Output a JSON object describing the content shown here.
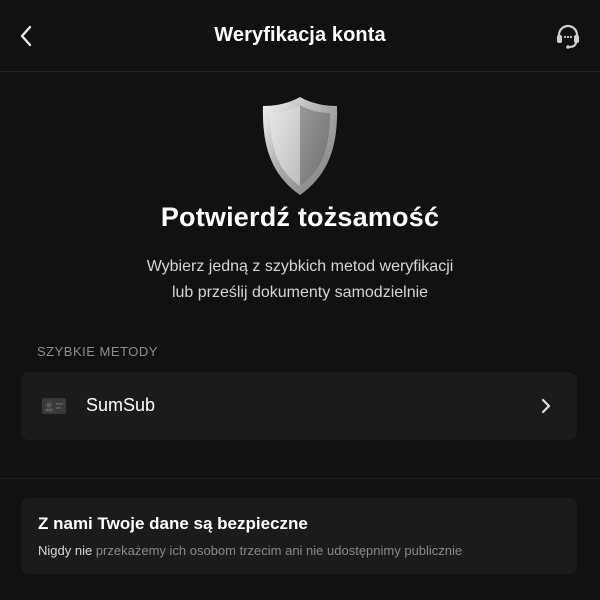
{
  "header": {
    "title": "Weryfikacja konta",
    "back_icon": "chevron-left-icon",
    "support_icon": "headset-support-icon"
  },
  "hero": {
    "icon": "shield-icon",
    "title": "Potwierdź tożsamość",
    "subtitle_line1": "Wybierz jedną z szybkich metod weryfikacji",
    "subtitle_line2": "lub prześlij dokumenty samodzielnie"
  },
  "quick_methods": {
    "section_label": "SZYBKIE METODY",
    "items": [
      {
        "label": "SumSub",
        "icon": "id-card-icon",
        "trailing_icon": "chevron-right-icon"
      }
    ]
  },
  "info": {
    "title": "Z nami Twoje dane są bezpieczne",
    "text_emphasis": "Nigdy nie",
    "text_rest": " przekażemy ich osobom trzecim ani nie udostępnimy publicznie"
  },
  "colors": {
    "background": "#111111",
    "card": "#1b1b1b",
    "text_primary": "#ffffff",
    "text_secondary": "#8a8a8a"
  }
}
